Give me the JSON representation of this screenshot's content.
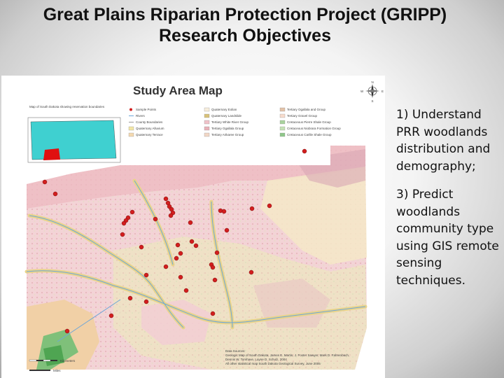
{
  "slide": {
    "title_line1": "Great Plains Riparian Protection Project (GRIPP)",
    "title_line2": "Research Objectives"
  },
  "map": {
    "title": "Study Area Map",
    "inset_caption": "Map of South Dakota showing reservation boundaries",
    "compass": {
      "n": "N",
      "s": "S",
      "e": "E",
      "w": "W"
    },
    "legend": [
      {
        "label": "Sample Points",
        "color": "#d21e1e"
      },
      {
        "label": "Rivers",
        "color": "#6ea6d8"
      },
      {
        "label": "County Boundaries",
        "color": "#999999"
      },
      {
        "label": "Quaternary Alluvium",
        "color": "#f2e6a6"
      },
      {
        "label": "Quaternary Terrace",
        "color": "#f4d9b0"
      },
      {
        "label": "Quaternary Eolian",
        "color": "#f7eedd"
      },
      {
        "label": "Quaternary Landslide",
        "color": "#d9c27a"
      },
      {
        "label": "Tertiary White River Group",
        "color": "#f0c2c9"
      },
      {
        "label": "Tertiary Ogallala Group",
        "color": "#e8b1b8"
      },
      {
        "label": "Tertiary Arikaree Group",
        "color": "#f2d7c6"
      },
      {
        "label": "Tertiary Ogallala and Group",
        "color": "#e3c2a8"
      },
      {
        "label": "Tertiary Gravel Group",
        "color": "#f7dccd"
      },
      {
        "label": "Cretaceous Pierre Shale Group",
        "color": "#a9d29d"
      },
      {
        "label": "Cretaceous Niobrara Formation Group",
        "color": "#c5e1b6"
      },
      {
        "label": "Cretaceous Carlile Shale Group",
        "color": "#8fc78a"
      }
    ],
    "source_text": [
      "Data Sources:",
      "Geologic Map of South Dakota, James E. Martin, J. Foster Sawyer, Mark D. Fahrenbach,",
      "Dennis W. Tomhave, Layne D. Schulz, 2004",
      "All other statistical map South Dakota Geological Survey, June 2005"
    ],
    "scale_units": [
      "Kilometers",
      "Miles"
    ]
  },
  "objectives": [
    {
      "text": "1) Understand PRR woodlands distribution and demography;"
    },
    {
      "text": "3) Predict woodlands community type using GIS remote sensing techniques."
    }
  ],
  "colors": {
    "sample_point": "#d21e1e",
    "river": "#6ea6d8",
    "pierre_shale": "#a9d29d",
    "white_river": "#f0c2c9",
    "alluvium": "#f2e6a6",
    "inset_state": "#3fd0d0",
    "inset_reservation": "#e01010"
  }
}
